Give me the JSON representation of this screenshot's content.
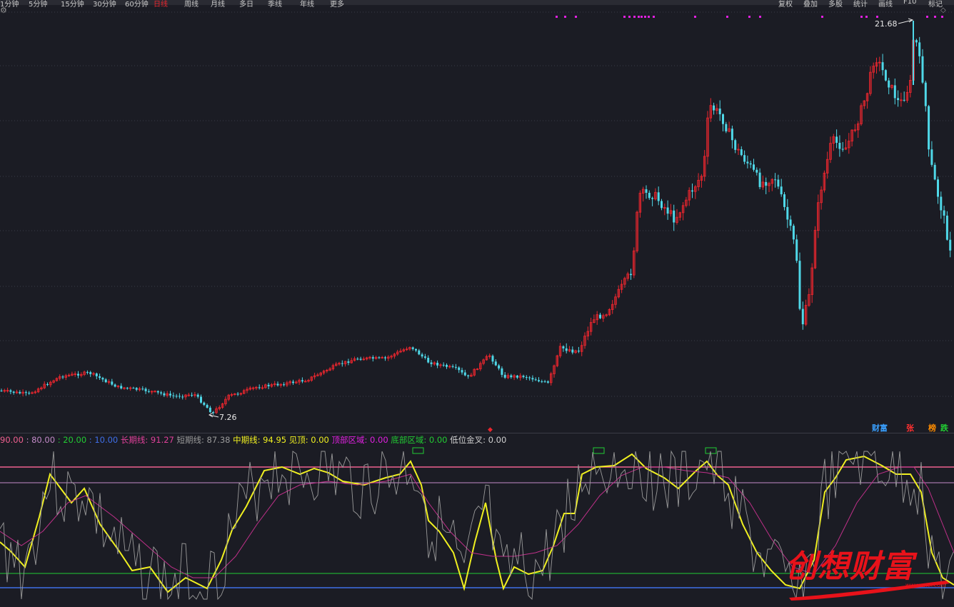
{
  "toolbar": {
    "left_items": [
      "1分钟",
      "5分钟",
      "15分钟",
      "30分钟",
      "60分钟",
      "日线",
      "周线",
      "月线",
      "多日",
      "季线",
      "年线",
      "更多"
    ],
    "right_items": [
      "复权",
      "叠加",
      "多股",
      "统计",
      "画线",
      "F10",
      "标记"
    ]
  },
  "main_chart": {
    "type": "candlestick",
    "high_label": "21.68",
    "low_label": "7.26",
    "colors": {
      "up": "#e8262e",
      "down": "#4fd8e8",
      "grid": "#3a3b47"
    }
  },
  "indicator": {
    "levels": [
      {
        "text": "90.00",
        "color": "#f06090"
      },
      {
        "text": "80.00",
        "color": "#c38ac8"
      },
      {
        "text": "20.00",
        "color": "#22cc33"
      },
      {
        "text": "10.00",
        "color": "#3f6ee8"
      }
    ],
    "values": [
      {
        "label": "长期线: ",
        "value": "91.27",
        "color": "#e0409a"
      },
      {
        "label": "短期线: ",
        "value": "87.38",
        "color": "#9a9a9a"
      },
      {
        "label": "中期线: ",
        "value": "94.95",
        "color": "#f0f020"
      },
      {
        "label": "见顶: ",
        "value": "0.00",
        "color": "#f0f020"
      },
      {
        "label": "顶部区域: ",
        "value": "0.00",
        "color": "#e020e0"
      },
      {
        "label": "底部区域: ",
        "value": "0.00",
        "color": "#22cc33"
      },
      {
        "label": "低位金叉: ",
        "value": "0.00",
        "color": "#d0d0d0"
      }
    ]
  },
  "tags": [
    {
      "text": "财富",
      "color": "#3aa0ff"
    },
    {
      "text": "张",
      "color": "#ff3030"
    },
    {
      "text": "榜",
      "color": "#ff8c00"
    },
    {
      "text": "跌",
      "color": "#22cc33"
    }
  ],
  "watermark": {
    "text": "创想财富",
    "url": "www.cxcf.com"
  }
}
